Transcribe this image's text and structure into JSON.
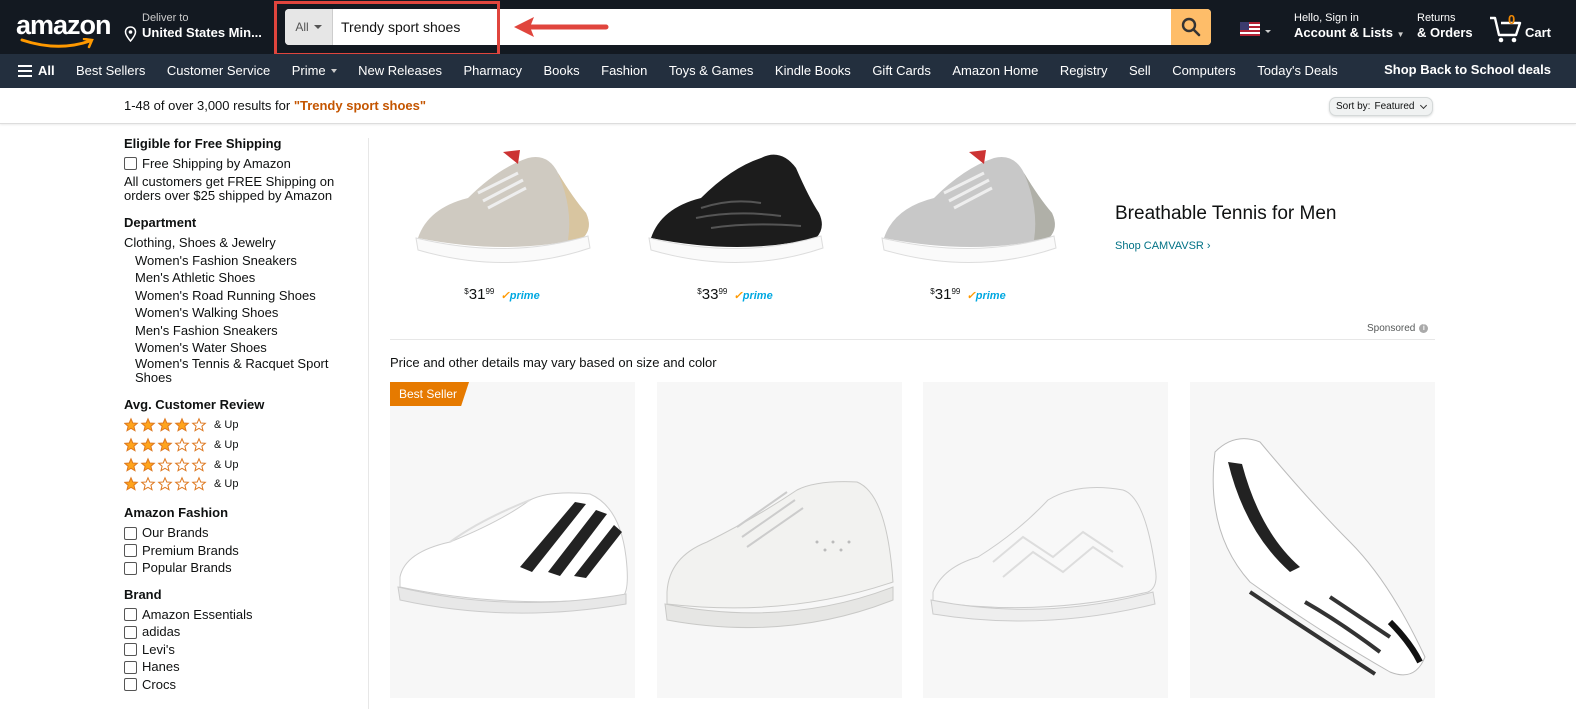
{
  "header": {
    "logo_text": "amazon",
    "deliver_label": "Deliver to",
    "deliver_location": "United States Min...",
    "search_category": "All",
    "search_query": "Trendy sport shoes",
    "account_greeting": "Hello, Sign in",
    "account_label": "Account & Lists",
    "returns_label": "Returns",
    "orders_label": "& Orders",
    "cart_count": "0",
    "cart_label": "Cart"
  },
  "nav": {
    "all_label": "All",
    "items": [
      "Best Sellers",
      "Customer Service",
      "Prime",
      "New Releases",
      "Pharmacy",
      "Books",
      "Fashion",
      "Toys & Games",
      "Kindle Books",
      "Gift Cards",
      "Amazon Home",
      "Registry",
      "Sell",
      "Computers",
      "Today's Deals"
    ],
    "promo": "Shop Back to School deals"
  },
  "results": {
    "count_text": "1-48 of over 3,000 results for ",
    "query": "\"Trendy sport shoes\"",
    "sort_label": "Sort by:",
    "sort_value": "Featured"
  },
  "sidebar": {
    "shipping_heading": "Eligible for Free Shipping",
    "shipping_option": "Free Shipping by Amazon",
    "shipping_note": "All customers get FREE Shipping on orders over $25 shipped by Amazon",
    "department_heading": "Department",
    "department_top": "Clothing, Shoes & Jewelry",
    "departments": [
      "Women's Fashion Sneakers",
      "Men's Athletic Shoes",
      "Women's Road Running Shoes",
      "Women's Walking Shoes",
      "Men's Fashion Sneakers",
      "Women's Water Shoes",
      "Women's Tennis & Racquet Sport Shoes"
    ],
    "review_heading": "Avg. Customer Review",
    "review_suffix": "& Up",
    "review_levels": [
      4,
      3,
      2,
      1
    ],
    "fashion_heading": "Amazon Fashion",
    "fashion_options": [
      "Our Brands",
      "Premium Brands",
      "Popular Brands"
    ],
    "brand_heading": "Brand",
    "brands": [
      "Amazon Essentials",
      "adidas",
      "Levi's",
      "Hanes",
      "Crocs"
    ]
  },
  "sponsored": {
    "items": [
      {
        "dollars": "31",
        "cents": "99",
        "color": "gray-tan"
      },
      {
        "dollars": "33",
        "cents": "99",
        "color": "black"
      },
      {
        "dollars": "31",
        "cents": "99",
        "color": "gray"
      }
    ],
    "prime_label": "prime",
    "title": "Breathable Tennis for Men",
    "link": "Shop CAMVAVSR ›",
    "sponsored_label": "Sponsored"
  },
  "note": "Price and other details may vary based on size and color",
  "products": {
    "badge": "Best Seller"
  },
  "colors": {
    "header_bg": "#131921",
    "nav_bg": "#232f3e",
    "search_button": "#febd69",
    "accent_orange": "#c45500",
    "star": "#ffa41c",
    "link": "#007185",
    "badge": "#e67a00",
    "annotation_red": "#e0453d"
  }
}
